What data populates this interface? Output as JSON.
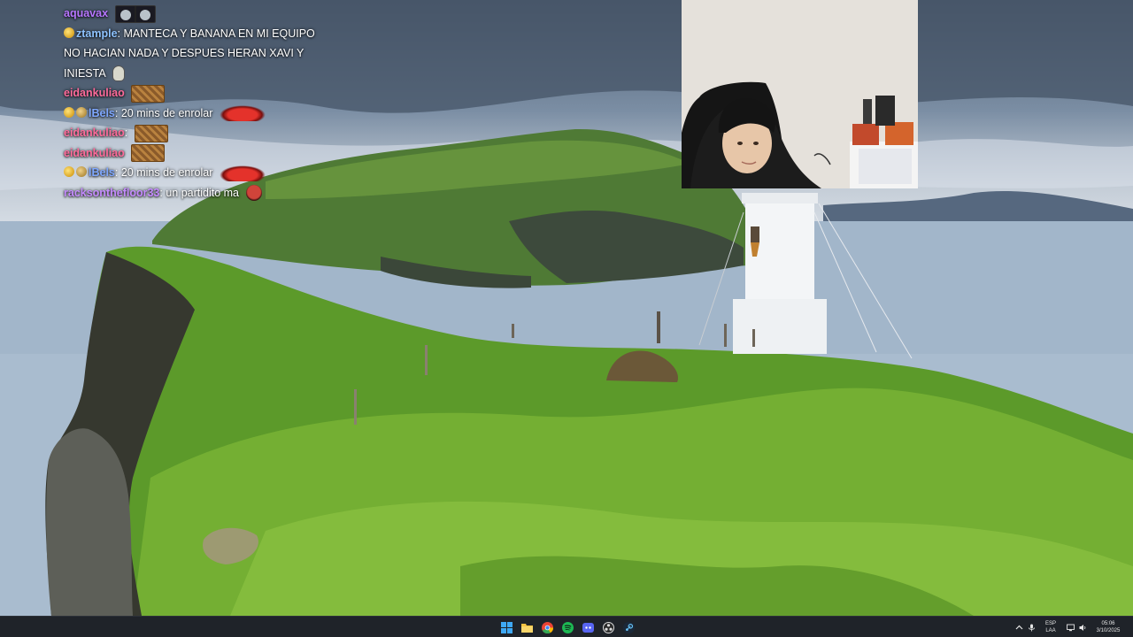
{
  "chat": {
    "messages": [
      {
        "user": "aquavax",
        "user_color": "#b776ff",
        "text": "",
        "emotes": [
          "pair-emote"
        ],
        "badges": []
      },
      {
        "user": "ztample",
        "user_color": "#8ec3ff",
        "text": "MANTECA Y BANANA EN MI EQUIPO NO HACIAN NADA Y DESPUES HERAN XAVI Y INIESTA",
        "emotes": [
          "skull-emote"
        ],
        "badges": [
          "gold"
        ]
      },
      {
        "user": "eidankuliao",
        "user_color": "#ff6b9b",
        "text": "",
        "emotes": [
          "bread-emote"
        ],
        "badges": []
      },
      {
        "user": "lBels",
        "user_color": "#7fa8ff",
        "text": "20 mins de enrolar",
        "emotes": [
          "car-emote"
        ],
        "badges": [
          "gold",
          "tan"
        ]
      },
      {
        "user": "eidankuliao",
        "user_color": "#ff6b9b",
        "text": "",
        "emotes": [
          "bread-emote"
        ],
        "badges": []
      },
      {
        "user": "eidankuliao",
        "user_color": "#ff6b9b",
        "text": "",
        "emotes": [
          "bread-emote"
        ],
        "badges": []
      },
      {
        "user": "lBels",
        "user_color": "#7fa8ff",
        "text": "20 mins de enrolar",
        "emotes": [
          "car-emote"
        ],
        "badges": [
          "gold",
          "tan"
        ]
      },
      {
        "user": "racksonthefloor33",
        "user_color": "#c58bff",
        "text": "un partidito ma",
        "emotes": [
          "face-emote"
        ],
        "badges": []
      }
    ]
  },
  "taskbar": {
    "apps": [
      {
        "name": "windows-start",
        "icon": "windows-icon",
        "color": "#3ea8f5"
      },
      {
        "name": "file-explorer",
        "icon": "folder-icon",
        "color": "#f6c342"
      },
      {
        "name": "chrome",
        "icon": "chrome-icon",
        "color": "#ea4335"
      },
      {
        "name": "spotify",
        "icon": "spotify-icon",
        "color": "#1db954"
      },
      {
        "name": "discord",
        "icon": "discord-icon",
        "color": "#5865f2"
      },
      {
        "name": "obs",
        "icon": "obs-icon",
        "color": "#dcdcdc"
      },
      {
        "name": "steam",
        "icon": "steam-icon",
        "color": "#66c0f4"
      }
    ],
    "tray": {
      "lang_primary": "ESP",
      "lang_secondary": "LAA",
      "time": "05:06",
      "date": "3/10/2025"
    }
  }
}
